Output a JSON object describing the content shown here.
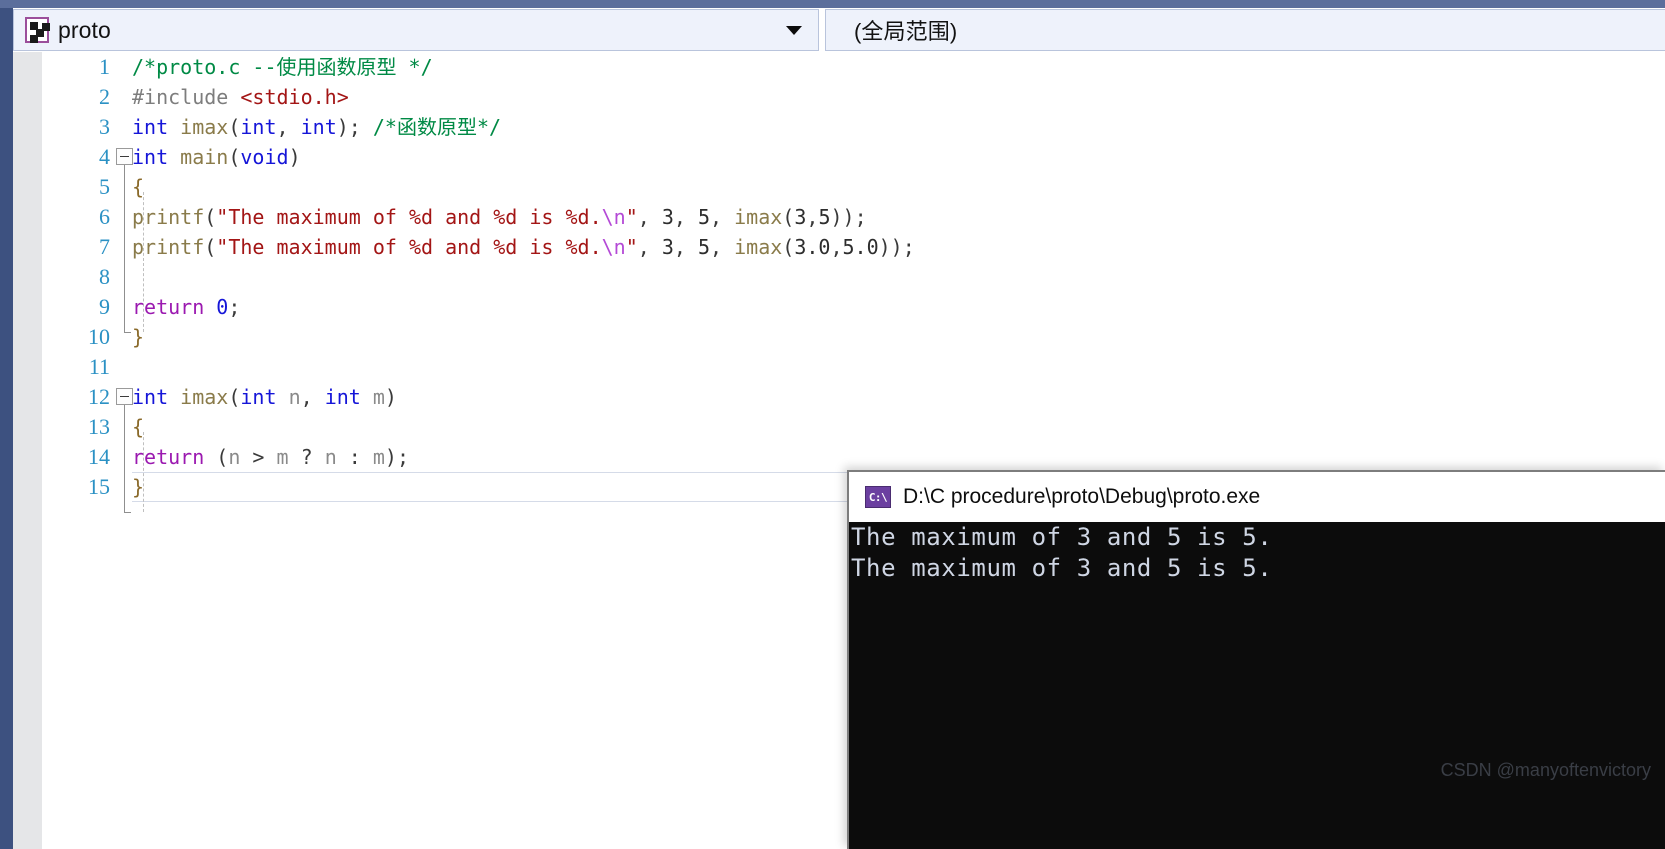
{
  "window": {
    "title": "proto"
  },
  "toolbar": {
    "scope_combo": {
      "icon": "project-cpp-icon",
      "value": "proto",
      "arrow": "chevron-down-icon"
    },
    "member_combo": {
      "value": "(全局范围)"
    }
  },
  "editor": {
    "language": "c",
    "filename": "proto.c",
    "line_numbers": [
      "1",
      "2",
      "3",
      "4",
      "5",
      "6",
      "7",
      "8",
      "9",
      "10",
      "11",
      "12",
      "13",
      "14",
      "15"
    ],
    "lines": [
      {
        "n": "1",
        "tokens": [
          {
            "t": "  ",
            "c": "t-plain"
          },
          {
            "t": "/*proto.c --使用函数原型 */",
            "c": "t-comment"
          }
        ]
      },
      {
        "n": "2",
        "tokens": [
          {
            "t": " ",
            "c": "t-plain"
          },
          {
            "t": "#include ",
            "c": "t-pre"
          },
          {
            "t": "<stdio.h>",
            "c": "t-inc"
          }
        ]
      },
      {
        "n": "3",
        "tokens": [
          {
            "t": " ",
            "c": "t-plain"
          },
          {
            "t": "int",
            "c": "t-kw"
          },
          {
            "t": " ",
            "c": "t-plain"
          },
          {
            "t": "imax",
            "c": "t-fn"
          },
          {
            "t": "(",
            "c": "t-punct"
          },
          {
            "t": "int",
            "c": "t-kw"
          },
          {
            "t": ", ",
            "c": "t-punct"
          },
          {
            "t": "int",
            "c": "t-kw"
          },
          {
            "t": ");",
            "c": "t-punct"
          },
          {
            "t": "        ",
            "c": "t-plain"
          },
          {
            "t": "/*函数原型*/",
            "c": "t-comment"
          }
        ]
      },
      {
        "n": "4",
        "tokens": [
          {
            "t": "int",
            "c": "t-kw"
          },
          {
            "t": " ",
            "c": "t-plain"
          },
          {
            "t": "main",
            "c": "t-fn"
          },
          {
            "t": "(",
            "c": "t-punct"
          },
          {
            "t": "void",
            "c": "t-kw"
          },
          {
            "t": ")",
            "c": "t-punct"
          }
        ]
      },
      {
        "n": "5",
        "tokens": [
          {
            "t": " {",
            "c": "t-brace"
          }
        ]
      },
      {
        "n": "6",
        "tokens": [
          {
            "t": "    ",
            "c": "t-plain"
          },
          {
            "t": "printf",
            "c": "t-fn"
          },
          {
            "t": "(",
            "c": "t-punct"
          },
          {
            "t": "\"The maximum of %d and %d is %d.",
            "c": "t-str"
          },
          {
            "t": "\\n",
            "c": "t-esc"
          },
          {
            "t": "\"",
            "c": "t-str"
          },
          {
            "t": ", ",
            "c": "t-punct"
          },
          {
            "t": "3",
            "c": "t-num"
          },
          {
            "t": ", ",
            "c": "t-punct"
          },
          {
            "t": "5",
            "c": "t-num"
          },
          {
            "t": ",  ",
            "c": "t-punct"
          },
          {
            "t": "imax",
            "c": "t-fn"
          },
          {
            "t": "(",
            "c": "t-punct"
          },
          {
            "t": "3",
            "c": "t-num"
          },
          {
            "t": ",",
            "c": "t-punct"
          },
          {
            "t": "5",
            "c": "t-num"
          },
          {
            "t": "));",
            "c": "t-punct"
          }
        ]
      },
      {
        "n": "7",
        "tokens": [
          {
            "t": "    ",
            "c": "t-plain"
          },
          {
            "t": "printf",
            "c": "t-fn"
          },
          {
            "t": "(",
            "c": "t-punct"
          },
          {
            "t": "\"The maximum of %d and %d is %d.",
            "c": "t-str"
          },
          {
            "t": "\\n",
            "c": "t-esc"
          },
          {
            "t": "\"",
            "c": "t-str"
          },
          {
            "t": ", ",
            "c": "t-punct"
          },
          {
            "t": "3",
            "c": "t-num"
          },
          {
            "t": ", ",
            "c": "t-punct"
          },
          {
            "t": "5",
            "c": "t-num"
          },
          {
            "t": ",  ",
            "c": "t-punct"
          },
          {
            "t": "imax",
            "c": "t-fn"
          },
          {
            "t": "(",
            "c": "t-punct"
          },
          {
            "t": "3.0",
            "c": "t-num"
          },
          {
            "t": ",",
            "c": "t-punct"
          },
          {
            "t": "5.0",
            "c": "t-num"
          },
          {
            "t": "));",
            "c": "t-punct"
          }
        ]
      },
      {
        "n": "8",
        "tokens": []
      },
      {
        "n": "9",
        "tokens": [
          {
            "t": "    ",
            "c": "t-plain"
          },
          {
            "t": "return",
            "c": "t-ret"
          },
          {
            "t": " ",
            "c": "t-plain"
          },
          {
            "t": "0",
            "c": "t-numblue"
          },
          {
            "t": ";",
            "c": "t-punct"
          }
        ]
      },
      {
        "n": "10",
        "tokens": [
          {
            "t": " }",
            "c": "t-brace"
          }
        ]
      },
      {
        "n": "11",
        "tokens": []
      },
      {
        "n": "12",
        "tokens": [
          {
            "t": "int",
            "c": "t-kw"
          },
          {
            "t": " ",
            "c": "t-plain"
          },
          {
            "t": "imax",
            "c": "t-fn"
          },
          {
            "t": "(",
            "c": "t-punct"
          },
          {
            "t": "int",
            "c": "t-kw"
          },
          {
            "t": " ",
            "c": "t-plain"
          },
          {
            "t": "n",
            "c": "t-id"
          },
          {
            "t": ", ",
            "c": "t-punct"
          },
          {
            "t": "int",
            "c": "t-kw"
          },
          {
            "t": " ",
            "c": "t-plain"
          },
          {
            "t": "m",
            "c": "t-id"
          },
          {
            "t": ")",
            "c": "t-punct"
          }
        ]
      },
      {
        "n": "13",
        "tokens": [
          {
            "t": " {",
            "c": "t-brace"
          }
        ]
      },
      {
        "n": "14",
        "tokens": [
          {
            "t": "    ",
            "c": "t-plain"
          },
          {
            "t": "return",
            "c": "t-ret"
          },
          {
            "t": " ",
            "c": "t-plain"
          },
          {
            "t": "(",
            "c": "t-punct"
          },
          {
            "t": "n",
            "c": "t-id"
          },
          {
            "t": " > ",
            "c": "t-punct"
          },
          {
            "t": "m",
            "c": "t-id"
          },
          {
            "t": " ? ",
            "c": "t-punct"
          },
          {
            "t": "n",
            "c": "t-id"
          },
          {
            "t": " : ",
            "c": "t-punct"
          },
          {
            "t": "m",
            "c": "t-id"
          },
          {
            "t": ");",
            "c": "t-punct"
          }
        ]
      },
      {
        "n": "15",
        "tokens": [
          {
            "t": " }",
            "c": "t-brace"
          }
        ]
      }
    ],
    "fold_markers": [
      "4",
      "12"
    ],
    "current_line": "15"
  },
  "console": {
    "icon": "command-prompt-icon",
    "icon_text": "C:\\",
    "title": "D:\\C procedure\\proto\\Debug\\proto.exe",
    "output": [
      "The maximum of 3 and 5 is 5.",
      "The maximum of 3 and 5 is 5."
    ],
    "watermark": "CSDN @manyoftenvictory"
  },
  "colors": {
    "rail": "#3d5180",
    "gutter": "#e5e6e8",
    "combo_bg": "#eef2fb",
    "comment": "#008a45",
    "keyword": "#1515d8",
    "string": "#a31515",
    "escape": "#b44ad6",
    "return_kw": "#9b19b0",
    "function": "#8a7b4a",
    "lineno": "#2b91c4",
    "console_bg": "#0c0c0c",
    "console_fg": "#cfd6e4"
  }
}
